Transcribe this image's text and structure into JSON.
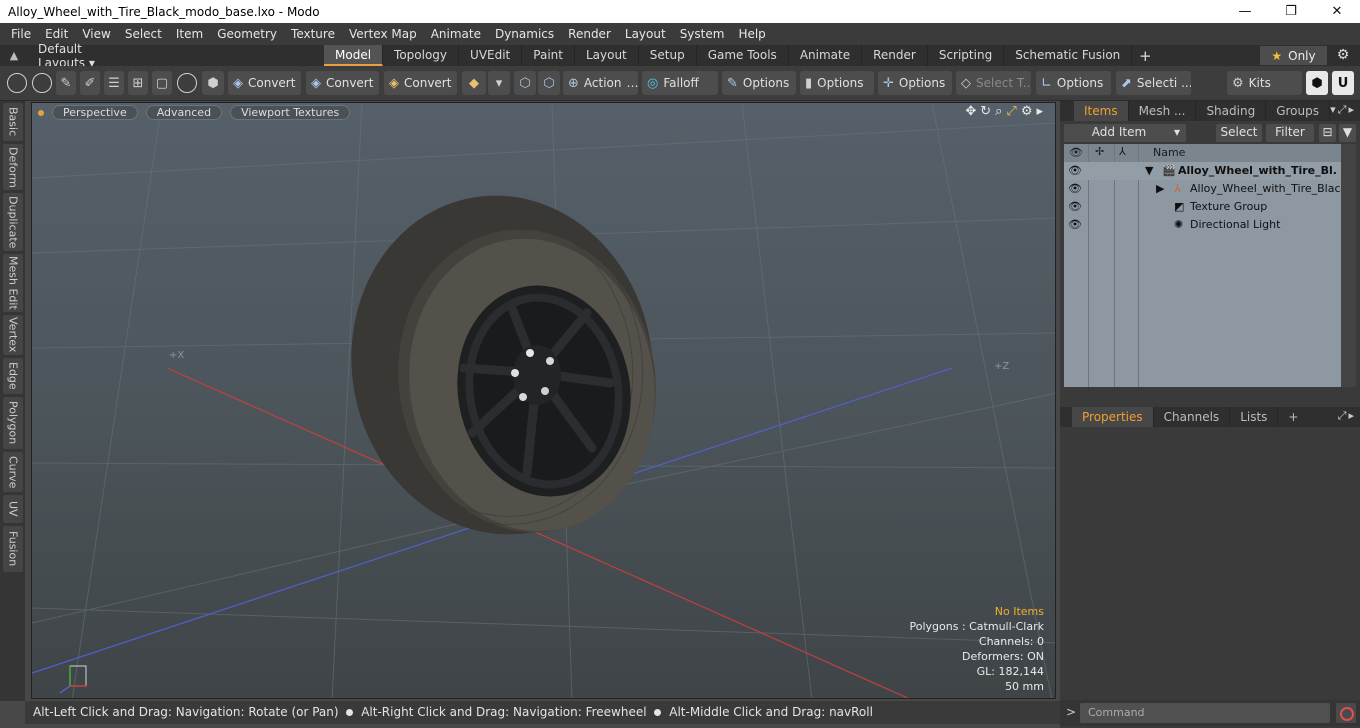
{
  "window": {
    "title": "Alloy_Wheel_with_Tire_Black_modo_base.lxo - Modo",
    "minimize": "—",
    "maximize": "❐",
    "close": "✕"
  },
  "menu": [
    "File",
    "Edit",
    "View",
    "Select",
    "Item",
    "Geometry",
    "Texture",
    "Vertex Map",
    "Animate",
    "Dynamics",
    "Render",
    "Layout",
    "System",
    "Help"
  ],
  "layoutbar": {
    "default_layouts": "Default Layouts ▾",
    "tabs": [
      "Model",
      "Topology",
      "UVEdit",
      "Paint",
      "Layout",
      "Setup",
      "Game Tools",
      "Animate",
      "Render",
      "Scripting",
      "Schematic Fusion"
    ],
    "active_tab": "Model",
    "only_label": "Only"
  },
  "toolbar": {
    "convert1": "Convert",
    "convert2": "Convert",
    "convert3": "Convert",
    "action": "Action",
    "falloff": "Falloff",
    "options1": "Options",
    "options2": "Options",
    "options3": "Options",
    "select_t": "Select T...",
    "options4": "Options",
    "selecti": "Selecti ...",
    "kits": "Kits"
  },
  "left_tabs": [
    "Basic",
    "Deform",
    "Duplicate",
    "Mesh Edit",
    "Vertex",
    "Edge",
    "Polygon",
    "Curve",
    "UV",
    "Fusion"
  ],
  "viewport": {
    "perspective": "Perspective",
    "advanced": "Advanced",
    "viewport_textures": "Viewport Textures",
    "axis_x_label": "+X",
    "axis_z_label": "+Z",
    "info": {
      "no_items": "No Items",
      "polygons": "Polygons : Catmull-Clark",
      "channels": "Channels: 0",
      "deformers": "Deformers: ON",
      "gl": "GL: 182,144",
      "scale": "50 mm"
    }
  },
  "status": {
    "hint1": "Alt-Left Click and Drag: Navigation: Rotate (or Pan)",
    "hint2": "Alt-Right Click and Drag: Navigation: Freewheel",
    "hint3": "Alt-Middle Click and Drag: navRoll"
  },
  "items_panel": {
    "tabs": [
      "Items",
      "Mesh ...",
      "Shading",
      "Groups"
    ],
    "add_item": "Add Item",
    "select": "Select",
    "filter": "Filter",
    "name_header": "Name",
    "rows": [
      {
        "label": "Alloy_Wheel_with_Tire_Bl..."
      },
      {
        "label": "Alloy_Wheel_with_Tire_Blac ..."
      },
      {
        "label": "Texture Group"
      },
      {
        "label": "Directional Light"
      }
    ]
  },
  "properties_panel": {
    "tabs": [
      "Properties",
      "Channels",
      "Lists"
    ],
    "plus": "+"
  },
  "command": {
    "placeholder": "Command"
  }
}
